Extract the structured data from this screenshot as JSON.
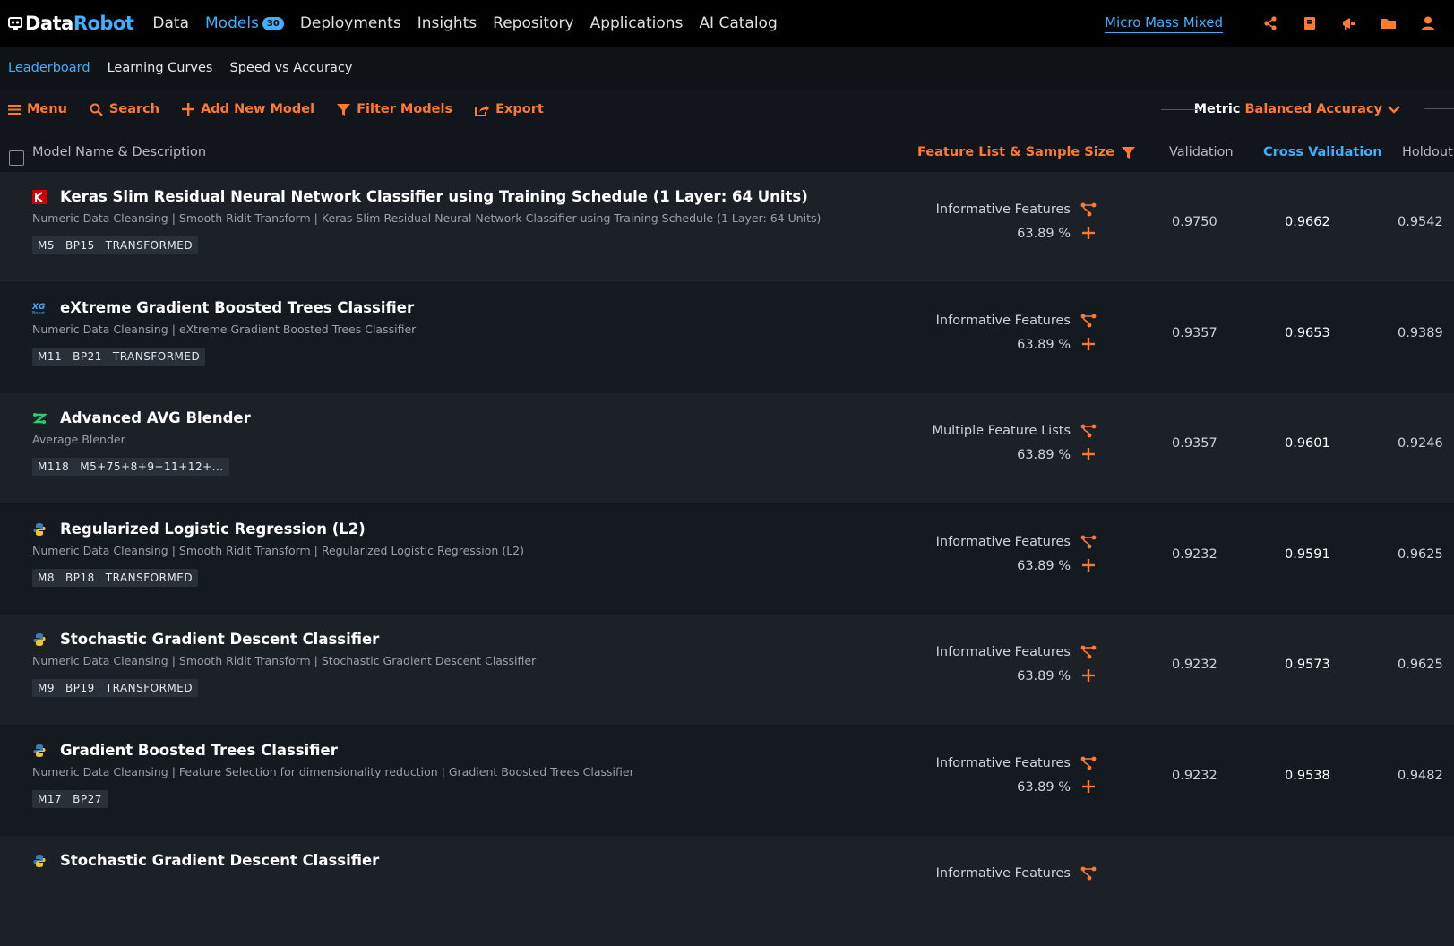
{
  "app": {
    "logo_data": "Data",
    "logo_robot": "Robot",
    "nav": [
      {
        "label": "Data"
      },
      {
        "label": "Models",
        "badge": "30"
      },
      {
        "label": "Deployments"
      },
      {
        "label": "Insights"
      },
      {
        "label": "Repository"
      },
      {
        "label": "Applications"
      },
      {
        "label": "AI Catalog"
      }
    ],
    "project_name": "Micro Mass Mixed",
    "icons": [
      "share-icon",
      "book-icon",
      "megaphone-icon",
      "folder-icon",
      "user-icon"
    ]
  },
  "subnav": [
    "Leaderboard",
    "Learning Curves",
    "Speed vs Accuracy"
  ],
  "toolbar": {
    "menu": "Menu",
    "search": "Search",
    "add": "Add New Model",
    "filter": "Filter Models",
    "export": "Export",
    "metric_label": "Metric",
    "metric_value": "Balanced Accuracy"
  },
  "columns": {
    "name": "Model Name & Description",
    "feature": "Feature List & Sample Size",
    "validation": "Validation",
    "cross_validation": "Cross Validation",
    "holdout": "Holdout"
  },
  "colors": {
    "accent_orange": "#ff7a2e",
    "accent_blue": "#3db0ff"
  },
  "models": [
    {
      "icon": "keras-icon",
      "title": "Keras Slim Residual Neural Network Classifier using Training Schedule (1 Layer: 64 Units)",
      "desc": "Numeric Data Cleansing | Smooth Ridit Transform | Keras Slim Residual Neural Network Classifier using Training Schedule (1 Layer: 64 Units)",
      "tags": [
        "M5",
        "BP15",
        "TRANSFORMED"
      ],
      "feature_list": "Informative Features",
      "sample": "63.89 %",
      "validation": "0.9750",
      "cv": "0.9662",
      "holdout": "0.9542"
    },
    {
      "icon": "xgboost-icon",
      "title": "eXtreme Gradient Boosted Trees Classifier",
      "desc": "Numeric Data Cleansing | eXtreme Gradient Boosted Trees Classifier",
      "tags": [
        "M11",
        "BP21",
        "TRANSFORMED"
      ],
      "feature_list": "Informative Features",
      "sample": "63.89 %",
      "validation": "0.9357",
      "cv": "0.9653",
      "holdout": "0.9389"
    },
    {
      "icon": "blender-icon",
      "title": "Advanced AVG Blender",
      "desc": "Average Blender",
      "tags": [
        "M118",
        "M5+75+8+9+11+12+..."
      ],
      "feature_list": "Multiple Feature Lists",
      "sample": "63.89 %",
      "validation": "0.9357",
      "cv": "0.9601",
      "holdout": "0.9246"
    },
    {
      "icon": "python-icon",
      "title": "Regularized Logistic Regression (L2)",
      "desc": "Numeric Data Cleansing | Smooth Ridit Transform | Regularized Logistic Regression (L2)",
      "tags": [
        "M8",
        "BP18",
        "TRANSFORMED"
      ],
      "feature_list": "Informative Features",
      "sample": "63.89 %",
      "validation": "0.9232",
      "cv": "0.9591",
      "holdout": "0.9625"
    },
    {
      "icon": "python-icon",
      "title": "Stochastic Gradient Descent Classifier",
      "desc": "Numeric Data Cleansing | Smooth Ridit Transform | Stochastic Gradient Descent Classifier",
      "tags": [
        "M9",
        "BP19",
        "TRANSFORMED"
      ],
      "feature_list": "Informative Features",
      "sample": "63.89 %",
      "validation": "0.9232",
      "cv": "0.9573",
      "holdout": "0.9625"
    },
    {
      "icon": "python-icon",
      "title": "Gradient Boosted Trees Classifier",
      "desc": "Numeric Data Cleansing | Feature Selection for dimensionality reduction | Gradient Boosted Trees Classifier",
      "tags": [
        "M17",
        "BP27"
      ],
      "feature_list": "Informative Features",
      "sample": "63.89 %",
      "validation": "0.9232",
      "cv": "0.9538",
      "holdout": "0.9482"
    },
    {
      "icon": "python-icon",
      "title": "Stochastic Gradient Descent Classifier",
      "desc": "",
      "tags": [],
      "feature_list": "Informative Features",
      "sample": "",
      "validation": "",
      "cv": "",
      "holdout": ""
    }
  ]
}
